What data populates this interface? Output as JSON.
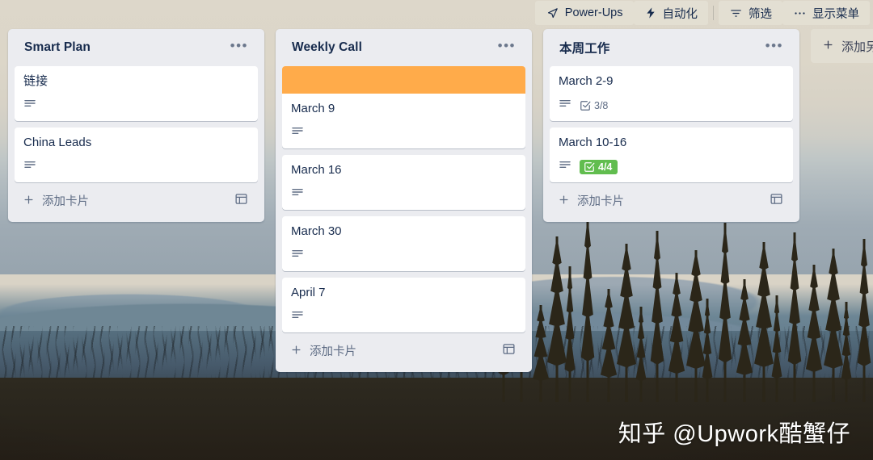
{
  "toolbar": {
    "buttons": [
      {
        "label": "Power-Ups",
        "icon": "rocket-icon"
      },
      {
        "label": "自动化",
        "icon": "lightning-bolt-icon"
      },
      {
        "label": "筛选",
        "icon": "filter-icon"
      },
      {
        "label": "显示菜单",
        "icon": "ellipsis-icon"
      }
    ]
  },
  "board": {
    "add_list_label": "添加另一个列表",
    "lists": [
      {
        "title": "Smart Plan",
        "menu_glyph": "•••",
        "add_card_label": "添加卡片",
        "add_card_plus": "+",
        "cards": [
          {
            "title": "链接",
            "cover_color": null,
            "has_description": true,
            "checklist": null,
            "checklist_complete": false
          },
          {
            "title": "China Leads",
            "cover_color": null,
            "has_description": true,
            "checklist": null,
            "checklist_complete": false
          }
        ]
      },
      {
        "title": "Weekly Call",
        "menu_glyph": "•••",
        "add_card_label": "添加卡片",
        "add_card_plus": "+",
        "cards": [
          {
            "title": "March 9",
            "cover_color": "#ffab4a",
            "has_description": true,
            "checklist": null,
            "checklist_complete": false
          },
          {
            "title": "March 16",
            "cover_color": null,
            "has_description": true,
            "checklist": null,
            "checklist_complete": false
          },
          {
            "title": "March 30",
            "cover_color": null,
            "has_description": true,
            "checklist": null,
            "checklist_complete": false
          },
          {
            "title": "April 7",
            "cover_color": null,
            "has_description": true,
            "checklist": null,
            "checklist_complete": false
          }
        ]
      },
      {
        "title": "本周工作",
        "menu_glyph": "•••",
        "add_card_label": "添加卡片",
        "add_card_plus": "+",
        "cards": [
          {
            "title": "March 2-9",
            "cover_color": null,
            "has_description": true,
            "checklist": "3/8",
            "checklist_complete": false
          },
          {
            "title": "March 10-16",
            "cover_color": null,
            "has_description": true,
            "checklist": "4/4",
            "checklist_complete": true
          }
        ]
      }
    ]
  },
  "watermark": {
    "text": "知乎 @Upwork酷蟹仔"
  },
  "colors": {
    "list_background": "#ebecf0",
    "card_background": "#ffffff",
    "text_primary": "#172b4d",
    "text_muted": "#5e6c84",
    "cover_orange": "#ffab4a",
    "badge_complete_green": "#61bd4f",
    "toolbar_button": "rgba(228,224,212,0.82)"
  }
}
